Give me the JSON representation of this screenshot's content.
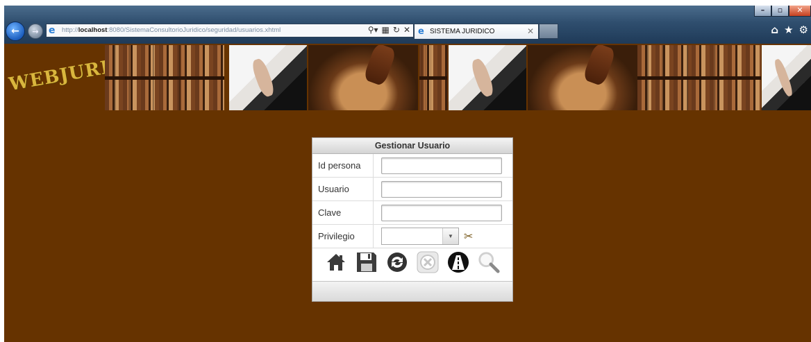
{
  "browser": {
    "address": {
      "scheme": "http://",
      "host": "localhost",
      "rest": ":8080/SistemaConsultorioJuridico/seguridad/usuarios.xhtml"
    },
    "tab_title": "SISTEMA JURIDICO",
    "icons": {
      "back": "back-arrow-icon",
      "forward": "forward-arrow-icon",
      "search": "search-icon",
      "compat": "compatibility-icon",
      "refresh": "refresh-icon",
      "stop": "stop-icon",
      "home": "home-icon",
      "favorites": "star-icon",
      "settings": "gear-icon"
    }
  },
  "page": {
    "logo": "WEBJURIS",
    "background_color": "#663300",
    "logo_color": "#d9b63d"
  },
  "form": {
    "title": "Gestionar Usuario",
    "fields": [
      {
        "label": "Id persona",
        "value": ""
      },
      {
        "label": "Usuario",
        "value": ""
      },
      {
        "label": "Clave",
        "value": ""
      },
      {
        "label": "Privilegio",
        "value": ""
      }
    ],
    "toolbar": [
      "home-icon",
      "save-icon",
      "refresh-icon",
      "cancel-icon",
      "road-icon",
      "search-icon"
    ]
  }
}
